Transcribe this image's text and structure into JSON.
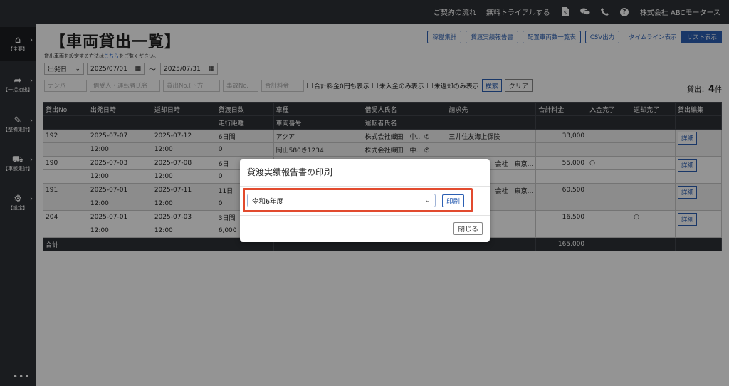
{
  "topbar": {
    "contract_flow": "ご契約の流れ",
    "free_trial": "無料トライアルする",
    "company": "株式会社 ABCモータース"
  },
  "sidebar": {
    "items": [
      {
        "label": "【主要】",
        "icon": "home-icon"
      },
      {
        "label": "【一括抽出】",
        "icon": "export-icon"
      },
      {
        "label": "【整備集計】",
        "icon": "wrench-icon"
      },
      {
        "label": "【車販集計】",
        "icon": "car-icon"
      },
      {
        "label": "【設定】",
        "icon": "gear-icon"
      }
    ],
    "more": "•••"
  },
  "header": {
    "title": "【車両貸出一覧】",
    "hint_prefix": "貸出車両を設定する方法は",
    "hint_link": "こちら",
    "hint_suffix": "をご覧ください。",
    "buttons": [
      "稼働集計",
      "貸渡実績報告書",
      "配置車両数一覧表",
      "CSV出力"
    ],
    "view_toggle": [
      "タイムライン表示",
      "リスト表示"
    ]
  },
  "filters": {
    "date_type": "出発日",
    "date_from": "2025/07/01",
    "tilde": "〜",
    "date_to": "2025/07/31",
    "placeholders": [
      "ナンバー",
      "借受人・運転者氏名",
      "貸出No.(下方一",
      "事故No.",
      "合計料金"
    ],
    "checkboxes": [
      "合計料金0円も表示",
      "未入金のみ表示",
      "未返却のみ表示"
    ],
    "search": "検索",
    "clear": "クリア"
  },
  "count": {
    "label": "貸出：",
    "value": "4",
    "unit": "件"
  },
  "table": {
    "headers_top": [
      "貸出No.",
      "出発日時",
      "返却日時",
      "貸渡日数",
      "車種",
      "借受人氏名",
      "請求先",
      "合計料金",
      "入金完了",
      "返却完了",
      "貸出編集"
    ],
    "headers_sub": [
      "",
      "",
      "",
      "走行距離",
      "車両番号",
      "運転者氏名",
      "",
      "",
      "",
      "",
      ""
    ],
    "rows": [
      {
        "no": "192",
        "dep_date": "2025-07-07",
        "dep_time": "12:00",
        "ret_date": "2025-07-12",
        "ret_time": "12:00",
        "days": "6日間",
        "km": "0",
        "model": "アクア",
        "plate": "岡山580き1234",
        "borrower": "株式会社織田　中...",
        "driver": "株式会社織田　中...",
        "bill": "三井住友海上保険",
        "total": "33,000",
        "paid": "",
        "returned": "",
        "edit": "詳細"
      },
      {
        "no": "190",
        "dep_date": "2025-07-03",
        "dep_time": "12:00",
        "ret_date": "2025-07-08",
        "ret_time": "12:00",
        "days": "6日",
        "km": "0",
        "model": "",
        "plate": "",
        "borrower": "",
        "driver": "",
        "bill": "会社　東京...",
        "total": "55,000",
        "paid": "○",
        "returned": "",
        "edit": "詳細"
      },
      {
        "no": "191",
        "dep_date": "2025-07-01",
        "dep_time": "12:00",
        "ret_date": "2025-07-11",
        "ret_time": "12:00",
        "days": "11日",
        "km": "0",
        "model": "",
        "plate": "",
        "borrower": "",
        "driver": "",
        "bill": "会社　東京...",
        "total": "60,500",
        "paid": "",
        "returned": "",
        "edit": "詳細"
      },
      {
        "no": "204",
        "dep_date": "2025-07-01",
        "dep_time": "12:00",
        "ret_date": "2025-07-03",
        "ret_time": "12:00",
        "days": "3日間",
        "km": "6,000",
        "model": "",
        "plate": "",
        "borrower": "",
        "driver": "",
        "bill": "",
        "total": "16,500",
        "paid": "",
        "returned": "○",
        "edit": "詳細"
      }
    ],
    "total_label": "合計",
    "total_value": "165,000"
  },
  "modal": {
    "title": "貸渡実績報告書の印刷",
    "select_value": "令和6年度",
    "print": "印刷",
    "close": "閉じる"
  },
  "colors": {
    "dark": "#2e3136",
    "accent": "#2b5fb3",
    "highlight": "#e24a2e"
  }
}
